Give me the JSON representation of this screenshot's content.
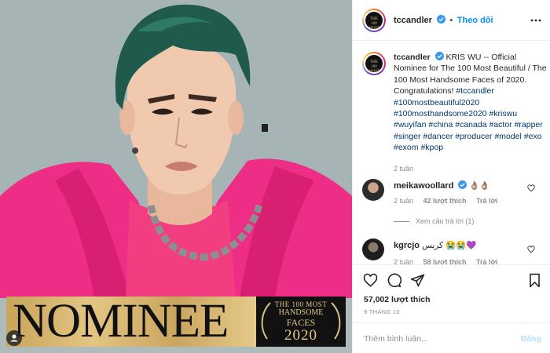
{
  "post": {
    "banner": {
      "nominee_text": "NOMINEE",
      "badge_line1": "THE",
      "badge_line1b": "100",
      "badge_line1c": "MOST",
      "badge_line2": "HANDSOME",
      "badge_line3": "FACES",
      "badge_year": "2020"
    }
  },
  "header": {
    "username": "tccandler",
    "separator": "•",
    "follow_label": "Theo dõi",
    "avatar_text_1": "THE",
    "avatar_text_2": "100",
    "avatar_text_3": "MOST"
  },
  "caption": {
    "username": "tccandler",
    "text": "KRIS WU -- Official Nominee for The 100 Most Beautiful / The 100 Most Handsome Faces of 2020. Congratulations!",
    "hashtags": [
      "#tccandler",
      "#100mostbeautiful2020",
      "#100mosthandsome2020",
      "#kriswu",
      "#wuyifan",
      "#china",
      "#canada",
      "#actor",
      "#rapper",
      "#singer",
      "#dancer",
      "#producer",
      "#model",
      "#exo",
      "#exom",
      "#kpop"
    ],
    "time": "2 tuần"
  },
  "comments": [
    {
      "username": "meikawoollard",
      "text": "👌🏽👌🏽",
      "time": "2 tuần",
      "likes": "42 lượt thích",
      "reply": "Trả lời",
      "view_replies": "Xem câu trả lời (1)"
    },
    {
      "username": "kgrcjo",
      "text": "كريس 😭😭💜",
      "time": "2 tuần",
      "likes": "58 lượt thích",
      "reply": "Trả lời"
    }
  ],
  "actions": {
    "likes": "57,002 lượt thích",
    "date": "9 THÁNG 10",
    "comment_placeholder": "Thêm bình luận...",
    "post_label": "Đăng"
  },
  "colors": {
    "accent": "#0095f6",
    "banner_gold": "#d9b96f",
    "jacket_pink": "#f0318a",
    "hair_green": "#1f5a4c"
  },
  "icons": [
    "verified-icon",
    "heart-icon",
    "comment-icon",
    "share-icon",
    "bookmark-icon",
    "user-tag-icon"
  ]
}
